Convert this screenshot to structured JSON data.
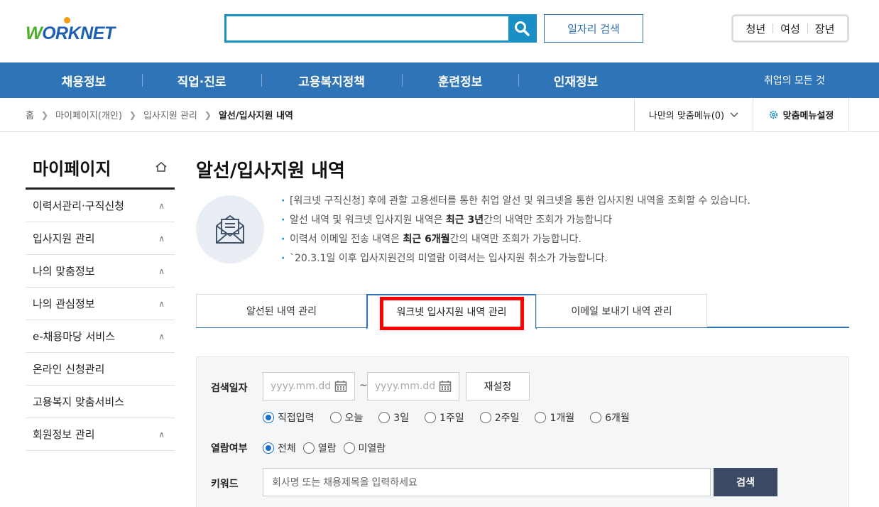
{
  "header": {
    "logo_text": "ORKNET",
    "logo_w": "W",
    "search": {
      "placeholder": "",
      "value": ""
    },
    "job_search_label": "일자리 검색",
    "target_links": [
      "청년",
      "여성",
      "장년"
    ]
  },
  "gnb": {
    "items": [
      "채용정보",
      "직업·진로",
      "고용복지정책",
      "훈련정보",
      "인재정보"
    ],
    "all_label": "취업의 모든 것"
  },
  "breadcrumb": {
    "items": [
      "홈",
      "마이페이지(개인)",
      "입사지원 관리",
      "알선/입사지원 내역"
    ],
    "my_menu": "나만의 맞춤메뉴(0)",
    "my_setting": "맞춤메뉴설정"
  },
  "sidebar": {
    "title": "마이페이지",
    "items": [
      {
        "label": "이력서관리·구직신청",
        "expandable": true
      },
      {
        "label": "입사지원 관리",
        "expandable": true
      },
      {
        "label": "나의 맞춤정보",
        "expandable": true
      },
      {
        "label": "나의 관심정보",
        "expandable": true
      },
      {
        "label": "e-채용마당 서비스",
        "expandable": true
      },
      {
        "label": "온라인 신청관리",
        "expandable": false
      },
      {
        "label": "고용복지 맞춤서비스",
        "expandable": false
      },
      {
        "label": "회원정보 관리",
        "expandable": true
      }
    ]
  },
  "main": {
    "title": "알선/입사지원 내역",
    "info": {
      "line1": "[워크넷 구직신청] 후에 관할 고용센터를 통한 취업 알선 및 워크넷을 통한 입사지원 내역을 조회할 수 있습니다.",
      "line2_pre": "알선 내역 및 워크넷 입사지원 내역은 ",
      "line2_bold": "최근 3년",
      "line2_post": "간의 내역만 조회가 가능합니다",
      "line3_pre": "이력서 이메일 전송 내역은 ",
      "line3_bold": "최근 6개월",
      "line3_post": "간의 내역만 조회가 가능합니다.",
      "line4": "`20.3.1일 이후 입사지원건의 미열람 이력서는 입사지원 취소가 가능합니다."
    },
    "tabs": [
      "알선된 내역 관리",
      "워크넷 입사지원 내역 관리",
      "이메일 보내기 내역 관리"
    ],
    "active_tab": 1,
    "search": {
      "date_label": "검색일자",
      "date_placeholder": "yyyy.mm.dd",
      "tilde": "~",
      "reset_label": "재설정",
      "period_options": [
        "직접입력",
        "오늘",
        "3일",
        "1주일",
        "2주일",
        "1개월",
        "6개월"
      ],
      "period_selected": "직접입력",
      "read_label": "열람여부",
      "read_options": [
        "전체",
        "열람",
        "미열람"
      ],
      "read_selected": "전체",
      "keyword_label": "키워드",
      "keyword_placeholder": "회사명 또는 채용제목을 입력하세요",
      "search_label": "검색"
    }
  },
  "colors": {
    "brand_blue": "#2e74b7",
    "search_blue": "#1a8fc6",
    "highlight": "#ff0000",
    "button_dark": "#3d4a66"
  }
}
